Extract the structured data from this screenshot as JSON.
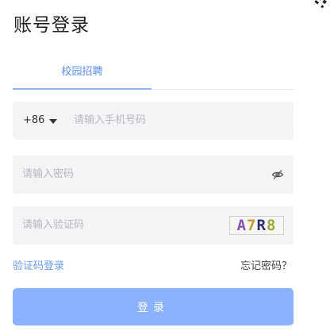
{
  "page": {
    "title": "账号登录"
  },
  "tabs": [
    {
      "label": "校园招聘",
      "active": true
    }
  ],
  "phone": {
    "country_code": "+86",
    "placeholder": "请输入手机号码"
  },
  "password": {
    "placeholder": "请输入密码",
    "toggle_icon": "eye-off-icon"
  },
  "captcha": {
    "placeholder": "请输入验证码",
    "code": [
      "A",
      "7",
      "R",
      "8"
    ]
  },
  "links": {
    "sms_login": "验证码登录",
    "forgot_password": "忘记密码？"
  },
  "login_button": {
    "label": "登录"
  },
  "colors": {
    "accent": "#8ab2ff",
    "link": "#6b9cf0",
    "field_bg": "#f4f4f6"
  }
}
